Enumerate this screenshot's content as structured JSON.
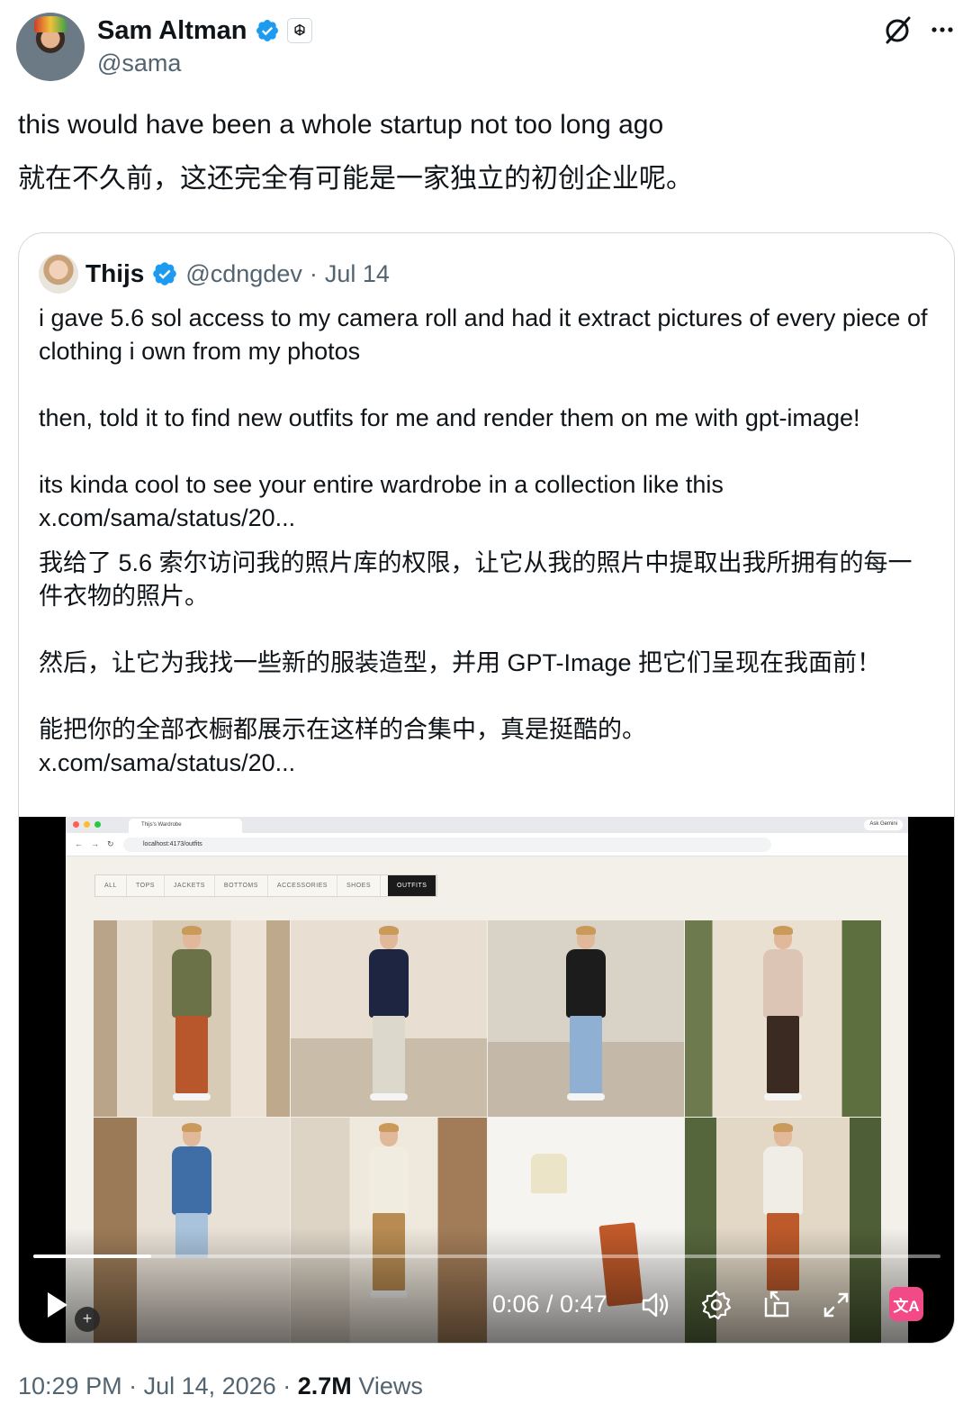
{
  "author": {
    "display_name": "Sam Altman",
    "handle": "@sama",
    "verified_icon": "verified-badge-icon",
    "affiliate_icon": "openai-logo-icon"
  },
  "header_actions": {
    "grok_icon": "grok-icon",
    "more_icon": "more-dots-icon"
  },
  "tweet": {
    "text": "this would have been a whole startup not too long ago",
    "translation": "就在不久前，这还完全有可能是一家独立的初创企业呢。"
  },
  "quote": {
    "display_name": "Thijs",
    "handle": "@cdngdev",
    "separator": "·",
    "date": "Jul 14",
    "text": "i gave 5.6 sol access to my camera roll and had it extract pictures of every piece of clothing i own from my photos\n\nthen, told it to find new outfits for me and render them on me with gpt-image!\n\nits kinda cool to see your entire wardrobe in a collection like this\nx.com/sama/status/20...",
    "translation": "我给了 5.6 索尔访问我的照片库的权限，让它从我的照片中提取出我所拥有的每一件衣物的照片。\n\n然后，让它为我找一些新的服装造型，并用 GPT-Image 把它们呈现在我面前！\n\n能把你的全部衣橱都展示在这样的合集中，真是挺酷的。\nx.com/sama/status/20..."
  },
  "video": {
    "browser": {
      "tab_title": "Thijs's Wardrobe",
      "url": "localhost:4173/outfits",
      "gemini_button": "Ask Gemini"
    },
    "filters": [
      "ALL",
      "TOPS",
      "JACKETS",
      "BOTTOMS",
      "ACCESSORIES",
      "SHOES"
    ],
    "active_filter": "OUTFITS",
    "time": "0:06 / 0:47",
    "progress": 0.13,
    "translate_label": "文A"
  },
  "footer": {
    "time": "10:29 PM",
    "sep1": "·",
    "date": "Jul 14, 2026",
    "sep2": "·",
    "views_count": "2.7M",
    "views_label": "Views"
  }
}
